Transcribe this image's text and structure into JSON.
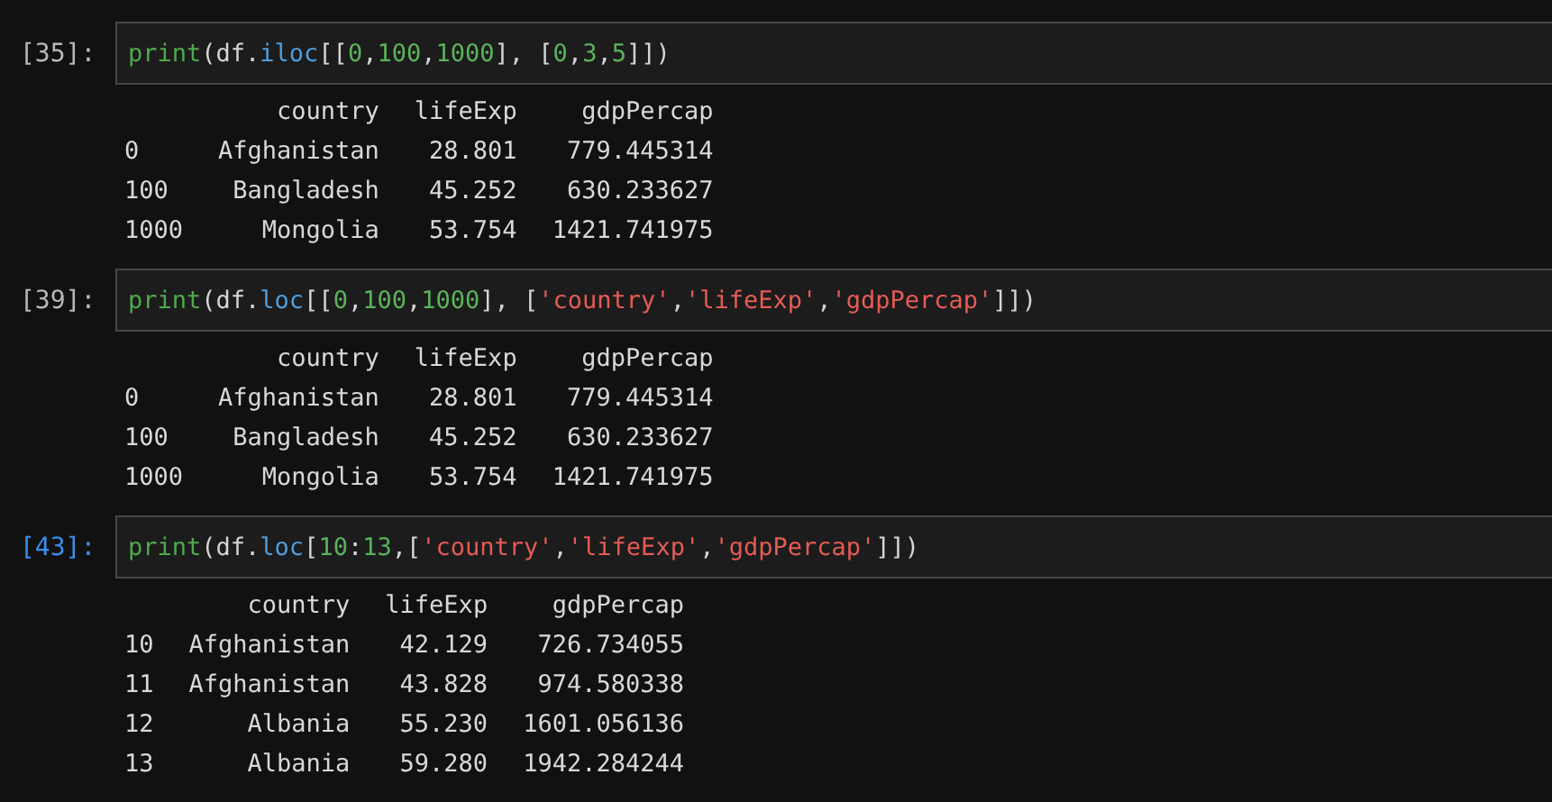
{
  "cells": [
    {
      "prompt": "[35]:",
      "selected": false,
      "code": [
        {
          "kind": "builtin",
          "text": "print"
        },
        {
          "kind": "plain",
          "text": "(df."
        },
        {
          "kind": "attr",
          "text": "iloc"
        },
        {
          "kind": "plain",
          "text": "[["
        },
        {
          "kind": "number",
          "text": "0"
        },
        {
          "kind": "plain",
          "text": ","
        },
        {
          "kind": "number",
          "text": "100"
        },
        {
          "kind": "plain",
          "text": ","
        },
        {
          "kind": "number",
          "text": "1000"
        },
        {
          "kind": "plain",
          "text": "], ["
        },
        {
          "kind": "number",
          "text": "0"
        },
        {
          "kind": "plain",
          "text": ","
        },
        {
          "kind": "number",
          "text": "3"
        },
        {
          "kind": "plain",
          "text": ","
        },
        {
          "kind": "number",
          "text": "5"
        },
        {
          "kind": "plain",
          "text": "]])"
        }
      ],
      "output": {
        "columns": [
          "country",
          "lifeExp",
          "gdpPercap"
        ],
        "rows": [
          {
            "index": "0",
            "values": [
              "Afghanistan",
              "28.801",
              "779.445314"
            ]
          },
          {
            "index": "100",
            "values": [
              "Bangladesh",
              "45.252",
              "630.233627"
            ]
          },
          {
            "index": "1000",
            "values": [
              "Mongolia",
              "53.754",
              "1421.741975"
            ]
          }
        ]
      }
    },
    {
      "prompt": "[39]:",
      "selected": false,
      "code": [
        {
          "kind": "builtin",
          "text": "print"
        },
        {
          "kind": "plain",
          "text": "(df."
        },
        {
          "kind": "attr",
          "text": "loc"
        },
        {
          "kind": "plain",
          "text": "[["
        },
        {
          "kind": "number",
          "text": "0"
        },
        {
          "kind": "plain",
          "text": ","
        },
        {
          "kind": "number",
          "text": "100"
        },
        {
          "kind": "plain",
          "text": ","
        },
        {
          "kind": "number",
          "text": "1000"
        },
        {
          "kind": "plain",
          "text": "], ["
        },
        {
          "kind": "string",
          "text": "'country'"
        },
        {
          "kind": "plain",
          "text": ","
        },
        {
          "kind": "string",
          "text": "'lifeExp'"
        },
        {
          "kind": "plain",
          "text": ","
        },
        {
          "kind": "string",
          "text": "'gdpPercap'"
        },
        {
          "kind": "plain",
          "text": "]])"
        }
      ],
      "output": {
        "columns": [
          "country",
          "lifeExp",
          "gdpPercap"
        ],
        "rows": [
          {
            "index": "0",
            "values": [
              "Afghanistan",
              "28.801",
              "779.445314"
            ]
          },
          {
            "index": "100",
            "values": [
              "Bangladesh",
              "45.252",
              "630.233627"
            ]
          },
          {
            "index": "1000",
            "values": [
              "Mongolia",
              "53.754",
              "1421.741975"
            ]
          }
        ]
      }
    },
    {
      "prompt": "[43]:",
      "selected": true,
      "code": [
        {
          "kind": "builtin",
          "text": "print"
        },
        {
          "kind": "plain",
          "text": "(df."
        },
        {
          "kind": "attr",
          "text": "loc"
        },
        {
          "kind": "plain",
          "text": "["
        },
        {
          "kind": "number",
          "text": "10"
        },
        {
          "kind": "plain",
          "text": ":"
        },
        {
          "kind": "number",
          "text": "13"
        },
        {
          "kind": "plain",
          "text": ",["
        },
        {
          "kind": "string",
          "text": "'country'"
        },
        {
          "kind": "plain",
          "text": ","
        },
        {
          "kind": "string",
          "text": "'lifeExp'"
        },
        {
          "kind": "plain",
          "text": ","
        },
        {
          "kind": "string",
          "text": "'gdpPercap'"
        },
        {
          "kind": "plain",
          "text": "]])"
        }
      ],
      "output": {
        "columns": [
          "country",
          "lifeExp",
          "gdpPercap"
        ],
        "rows": [
          {
            "index": "10",
            "values": [
              "Afghanistan",
              "42.129",
              "726.734055"
            ]
          },
          {
            "index": "11",
            "values": [
              "Afghanistan",
              "43.828",
              "974.580338"
            ]
          },
          {
            "index": "12",
            "values": [
              "Albania",
              "55.230",
              "1601.056136"
            ]
          },
          {
            "index": "13",
            "values": [
              "Albania",
              "59.280",
              "1942.284244"
            ]
          }
        ]
      }
    }
  ]
}
